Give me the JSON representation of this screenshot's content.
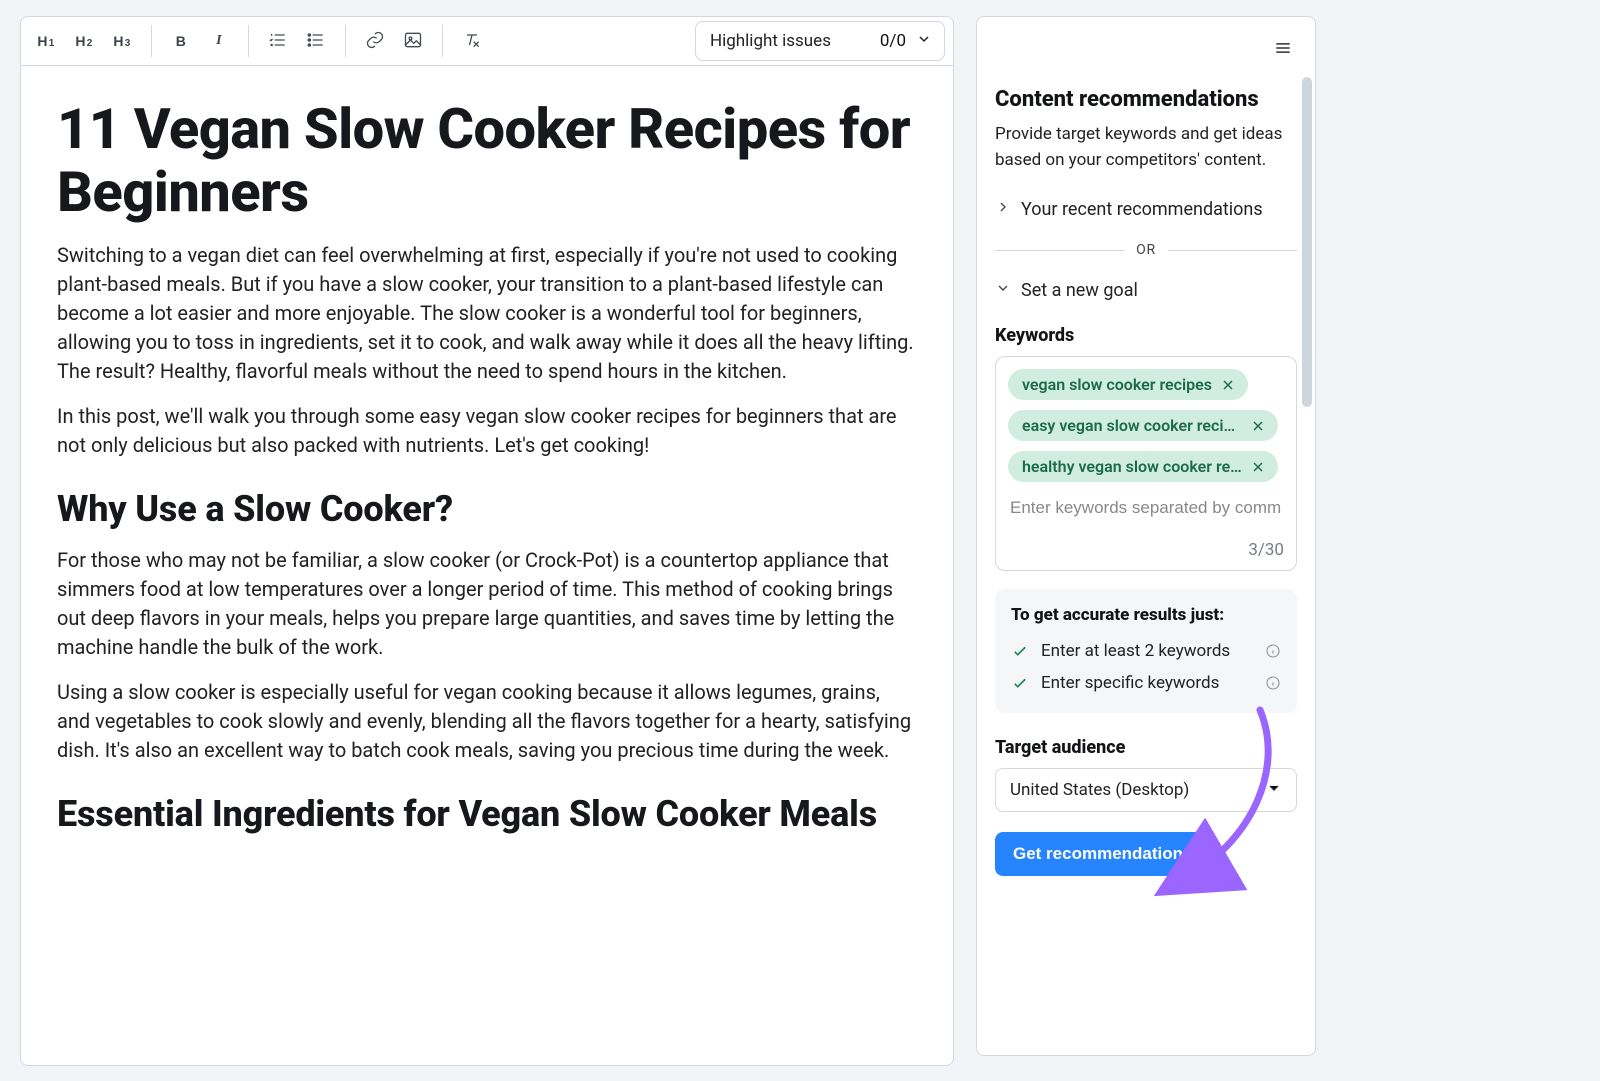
{
  "toolbar": {
    "headings": [
      "H",
      "H",
      "H"
    ],
    "heading_subs": [
      "1",
      "2",
      "3"
    ],
    "bold_label": "B",
    "italic_label": "I",
    "highlight_label": "Highlight issues",
    "highlight_count": "0/0"
  },
  "document": {
    "h1": "11 Vegan Slow Cooker Recipes for Beginners",
    "p1": "Switching to a vegan diet can feel overwhelming at first, especially if you're not used to cooking plant-based meals. But if you have a slow cooker, your transition to a plant-based lifestyle can become a lot easier and more enjoyable. The slow cooker is a wonderful tool for beginners, allowing you to toss in ingredients, set it to cook, and walk away while it does all the heavy lifting. The result? Healthy, flavorful meals without the need to spend hours in the kitchen.",
    "p2": "In this post, we'll walk you through some easy vegan slow cooker recipes for beginners that are not only delicious but also packed with nutrients. Let's get cooking!",
    "h2a": "Why Use a Slow Cooker?",
    "p3": "For those who may not be familiar, a slow cooker (or Crock-Pot) is a countertop appliance that simmers food at low temperatures over a longer period of time. This method of cooking brings out deep flavors in your meals, helps you prepare large quantities, and saves time by letting the machine handle the bulk of the work.",
    "p4": "Using a slow cooker is especially useful for vegan cooking because it allows legumes, grains, and vegetables to cook slowly and evenly, blending all the flavors together for a hearty, satisfying dish. It's also an excellent way to batch cook meals, saving you precious time during the week.",
    "h2b": "Essential Ingredients for Vegan Slow Cooker Meals"
  },
  "sidebar": {
    "title": "Content recommendations",
    "subtitle": "Provide target keywords and get ideas based on your competitors' content.",
    "recent_label": "Your recent recommendations",
    "or_label": "OR",
    "new_goal_label": "Set a new goal",
    "keywords_label": "Keywords",
    "keywords": [
      "vegan slow cooker recipes",
      "easy vegan slow cooker recipes",
      "healthy vegan slow cooker re…"
    ],
    "kw_placeholder": "Enter keywords separated by commas",
    "kw_count": "3/30",
    "hints_title": "To get accurate results just:",
    "hints": [
      "Enter at least 2 keywords",
      "Enter specific keywords"
    ],
    "target_label": "Target audience",
    "target_value": "United States (Desktop)",
    "cta_label": "Get recommendations"
  }
}
